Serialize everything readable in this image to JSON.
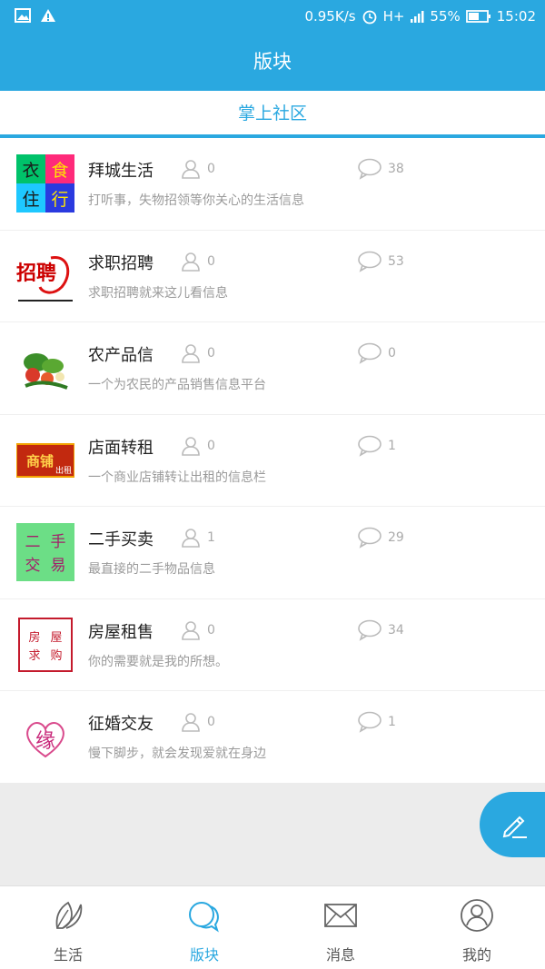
{
  "status_bar": {
    "speed": "0.95K/s",
    "network": "H+",
    "battery": "55%",
    "time": "15:02"
  },
  "header": {
    "title": "版块"
  },
  "section": {
    "title": "掌上社区"
  },
  "forums": [
    {
      "name": "拜城生活",
      "members": "0",
      "comments": "38",
      "desc": "打听事，失物招领等你关心的生活信息",
      "thumb_text": [
        "衣",
        "食",
        "住",
        "行"
      ]
    },
    {
      "name": "求职招聘",
      "members": "0",
      "comments": "53",
      "desc": "求职招聘就来这儿看信息",
      "thumb_text": [
        "招聘"
      ]
    },
    {
      "name": "农产品信",
      "members": "0",
      "comments": "0",
      "desc": "一个为农民的产品销售信息平台",
      "thumb_text": []
    },
    {
      "name": "店面转租",
      "members": "0",
      "comments": "1",
      "desc": "一个商业店铺转让出租的信息栏",
      "thumb_text": [
        "商铺",
        "出租"
      ]
    },
    {
      "name": "二手买卖",
      "members": "1",
      "comments": "29",
      "desc": "最直接的二手物品信息",
      "thumb_text": [
        "二",
        "手",
        "交",
        "易"
      ]
    },
    {
      "name": "房屋租售",
      "members": "0",
      "comments": "34",
      "desc": "你的需要就是我的所想。",
      "thumb_text": [
        "房",
        "屋",
        "求",
        "购"
      ]
    },
    {
      "name": "征婚交友",
      "members": "0",
      "comments": "1",
      "desc": "慢下脚步，就会发现爱就在身边",
      "thumb_text": [
        "缘"
      ]
    }
  ],
  "bottom_nav": [
    {
      "label": "生活",
      "icon": "leaf-icon"
    },
    {
      "label": "版块",
      "icon": "chat-bubbles-icon"
    },
    {
      "label": "消息",
      "icon": "envelope-icon"
    },
    {
      "label": "我的",
      "icon": "user-icon"
    }
  ],
  "colors": {
    "accent": "#2aa8e0",
    "muted": "#aaaaaa",
    "background": "#ececec"
  }
}
